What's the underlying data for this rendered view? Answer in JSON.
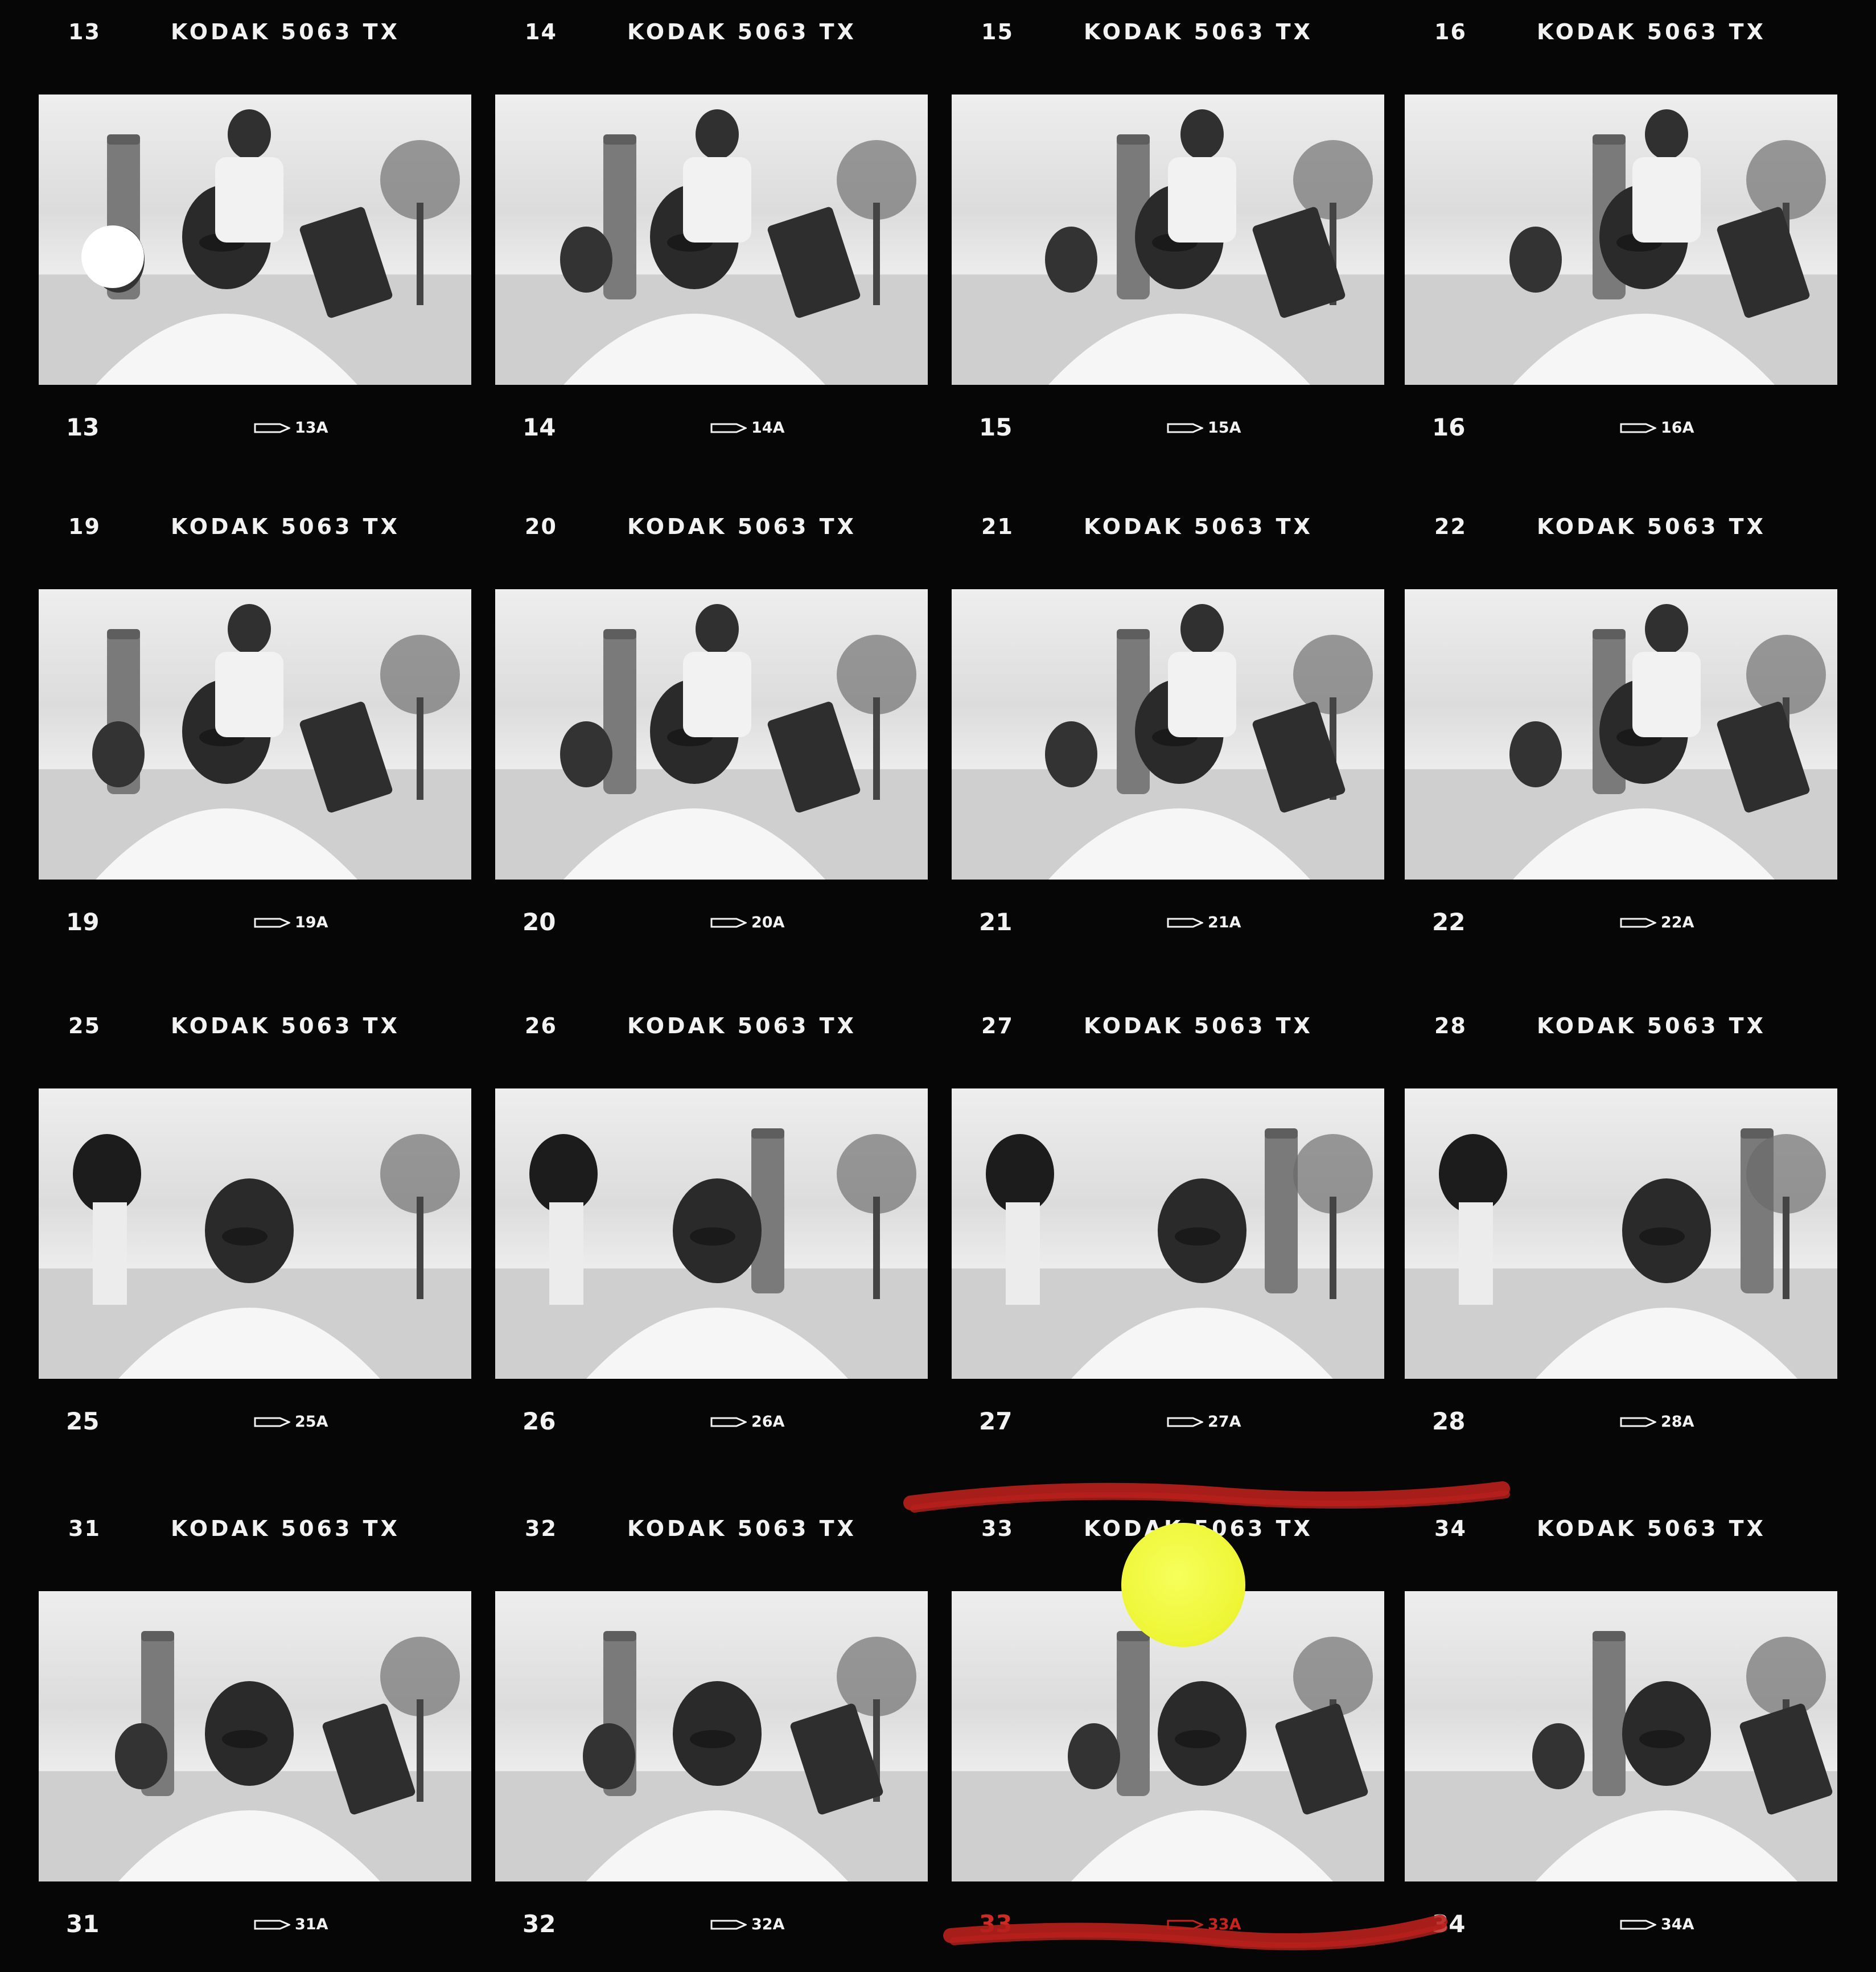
{
  "film": {
    "brand": "KODAK 5063 TX",
    "frames": [
      {
        "top": "13",
        "bottom": "13",
        "code": "13A"
      },
      {
        "top": "14",
        "bottom": "14",
        "code": "14A"
      },
      {
        "top": "15",
        "bottom": "15",
        "code": "15A"
      },
      {
        "top": "16",
        "bottom": "16",
        "code": "16A"
      },
      {
        "top": "19",
        "bottom": "19",
        "code": "19A"
      },
      {
        "top": "20",
        "bottom": "20",
        "code": "20A"
      },
      {
        "top": "21",
        "bottom": "21",
        "code": "21A"
      },
      {
        "top": "22",
        "bottom": "22",
        "code": "22A"
      },
      {
        "top": "25",
        "bottom": "25",
        "code": "25A"
      },
      {
        "top": "26",
        "bottom": "26",
        "code": "26A"
      },
      {
        "top": "27",
        "bottom": "27",
        "code": "27A"
      },
      {
        "top": "28",
        "bottom": "28",
        "code": "28A"
      },
      {
        "top": "31",
        "bottom": "31",
        "code": "31A"
      },
      {
        "top": "32",
        "bottom": "32",
        "code": "32A"
      },
      {
        "top": "33",
        "bottom": "33",
        "code": "33A"
      },
      {
        "top": "34",
        "bottom": "34",
        "code": "34A"
      }
    ]
  },
  "marks": {
    "selected_frame": "33",
    "marker_color": "#b8201c",
    "sticker_color": "#eef535"
  }
}
